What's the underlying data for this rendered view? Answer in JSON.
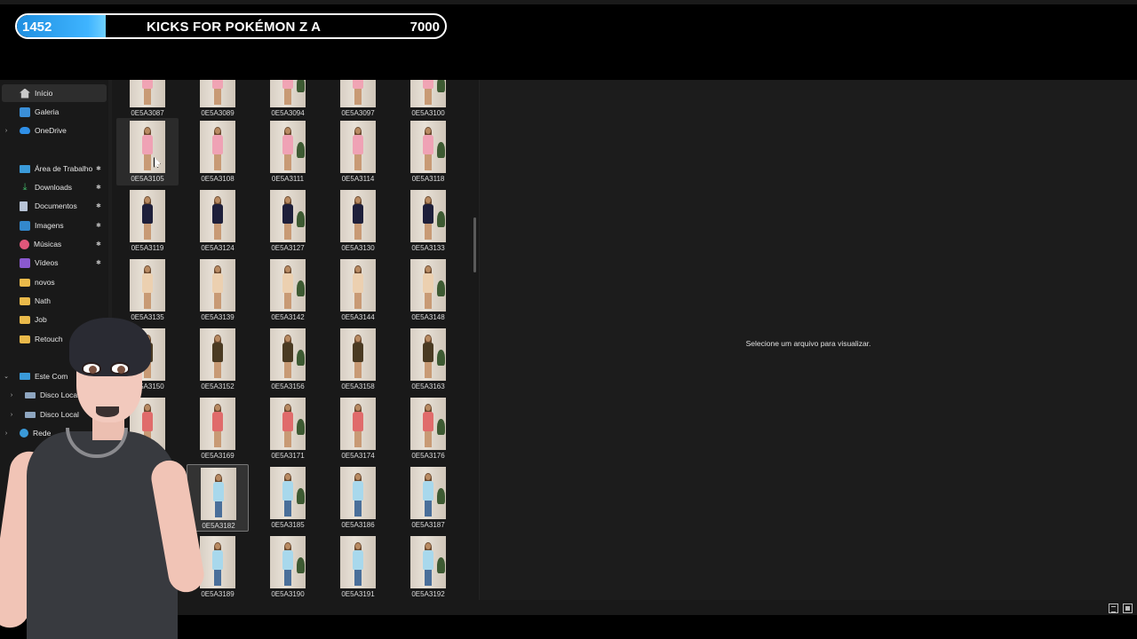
{
  "overlay": {
    "goal_current": "1452",
    "goal_title": "KICKS FOR POKÉMON Z A",
    "goal_target": "7000",
    "goal_progress": 0.2074,
    "accent": "#3fb4ff"
  },
  "sidebar": {
    "items": [
      {
        "label": "Início",
        "icon": "home-icon",
        "selected": true
      },
      {
        "label": "Galeria",
        "icon": "gallery-icon"
      },
      {
        "label": "OneDrive",
        "icon": "cloud-icon",
        "expandable": true
      },
      {
        "label": "Área de Trabalho",
        "icon": "desktop-icon",
        "pinned": true
      },
      {
        "label": "Downloads",
        "icon": "download-icon",
        "pinned": true
      },
      {
        "label": "Documentos",
        "icon": "document-icon",
        "pinned": true
      },
      {
        "label": "Imagens",
        "icon": "image-icon",
        "pinned": true
      },
      {
        "label": "Músicas",
        "icon": "music-icon",
        "pinned": true
      },
      {
        "label": "Vídeos",
        "icon": "video-icon",
        "pinned": true
      },
      {
        "label": "novos",
        "icon": "folder-icon"
      },
      {
        "label": "Nath",
        "icon": "folder-icon"
      },
      {
        "label": "Job",
        "icon": "folder-icon"
      },
      {
        "label": "Retouch",
        "icon": "folder-icon"
      },
      {
        "label": "Este Com",
        "icon": "pc-icon",
        "expandable": true,
        "expanded": true
      },
      {
        "label": "Disco Local",
        "icon": "disk-icon",
        "expandable": true
      },
      {
        "label": "Disco Local",
        "icon": "disk-icon",
        "expandable": true
      },
      {
        "label": "Rede",
        "icon": "network-icon",
        "expandable": true
      }
    ]
  },
  "files": [
    [
      "0E5A3087",
      "0E5A3089",
      "0E5A3094",
      "0E5A3097",
      "0E5A3100"
    ],
    [
      "0E5A3105",
      "0E5A3108",
      "0E5A3111",
      "0E5A3114",
      "0E5A3118"
    ],
    [
      "0E5A3119",
      "0E5A3124",
      "0E5A3127",
      "0E5A3130",
      "0E5A3133"
    ],
    [
      "0E5A3135",
      "0E5A3139",
      "0E5A3142",
      "0E5A3144",
      "0E5A3148"
    ],
    [
      "0E5A3150",
      "0E5A3152",
      "0E5A3156",
      "0E5A3158",
      "0E5A3163"
    ],
    [
      "165",
      "0E5A3169",
      "0E5A3171",
      "0E5A3174",
      "0E5A3176"
    ],
    [
      "",
      "0E5A3182",
      "0E5A3185",
      "0E5A3186",
      "0E5A3187"
    ],
    [
      "38",
      "0E5A3189",
      "0E5A3190",
      "0E5A3191",
      "0E5A3192"
    ]
  ],
  "row_outfit_colors": [
    "#f0a4b4",
    "#efa2b5",
    "#1e1f3a",
    "#ecd0b0",
    "#4a3a22",
    "#e06b6b",
    "#a8d8ec",
    "#a8d8ec"
  ],
  "preview": {
    "message": "Selecione um arquivo para visualizar."
  }
}
